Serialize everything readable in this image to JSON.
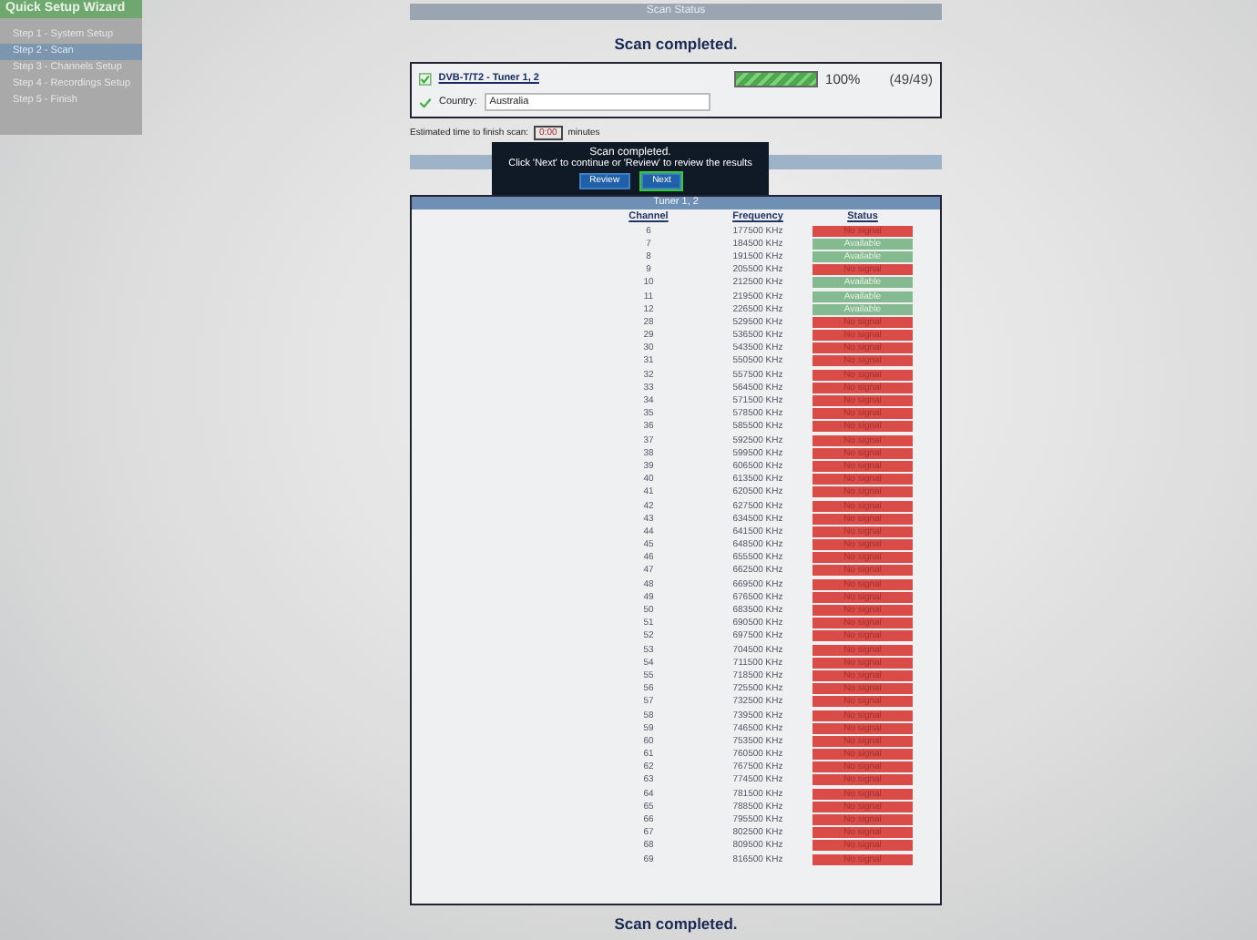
{
  "sidebar": {
    "title": "Quick Setup Wizard",
    "items": [
      {
        "label": "Step 1 - System Setup",
        "selected": false
      },
      {
        "label": "Step 2 - Scan",
        "selected": true
      },
      {
        "label": "Step 3 - Channels Setup",
        "selected": false
      },
      {
        "label": "Step 4 - Recordings Setup",
        "selected": false
      },
      {
        "label": "Step 5 - Finish",
        "selected": false
      }
    ]
  },
  "header": "Scan Status",
  "status_title": "Scan completed.",
  "tuner": {
    "name": "DVB-T/T2 - Tuner 1, 2",
    "level": 1,
    "percent": "100%",
    "count": "(49/49)",
    "country_label": "Country:",
    "country": "Australia"
  },
  "estimate": {
    "label": "Estimated time to finish scan:",
    "value": "0:00",
    "unit": "minutes"
  },
  "dialog": {
    "title": "Scan completed.",
    "message": "Click 'Next' to continue or 'Review' to review the results",
    "buttons": [
      {
        "label": "Review",
        "selected": false
      },
      {
        "label": "Next",
        "selected": true
      }
    ]
  },
  "table": {
    "title": "Tuner 1, 2",
    "columns": [
      "Channel",
      "Frequency",
      "Status"
    ],
    "rows": [
      {
        "channel": "6",
        "frequency": "177500 KHz",
        "status": "No signal",
        "kind": "none"
      },
      {
        "channel": "7",
        "frequency": "184500 KHz",
        "status": "Available",
        "kind": "available"
      },
      {
        "channel": "8",
        "frequency": "191500 KHz",
        "status": "Available",
        "kind": "available"
      },
      {
        "channel": "9",
        "frequency": "205500 KHz",
        "status": "No signal",
        "kind": "none"
      },
      {
        "channel": "10",
        "frequency": "212500 KHz",
        "status": "Available",
        "kind": "available"
      },
      {
        "channel": "11",
        "frequency": "219500 KHz",
        "status": "Available",
        "kind": "available"
      },
      {
        "channel": "12",
        "frequency": "226500 KHz",
        "status": "Available",
        "kind": "available"
      },
      {
        "channel": "28",
        "frequency": "529500 KHz",
        "status": "No signal",
        "kind": "none"
      },
      {
        "channel": "29",
        "frequency": "536500 KHz",
        "status": "No signal",
        "kind": "none"
      },
      {
        "channel": "30",
        "frequency": "543500 KHz",
        "status": "No signal",
        "kind": "none"
      },
      {
        "channel": "31",
        "frequency": "550500 KHz",
        "status": "No signal",
        "kind": "none"
      },
      {
        "channel": "32",
        "frequency": "557500 KHz",
        "status": "No signal",
        "kind": "none"
      },
      {
        "channel": "33",
        "frequency": "564500 KHz",
        "status": "No signal",
        "kind": "none"
      },
      {
        "channel": "34",
        "frequency": "571500 KHz",
        "status": "No signal",
        "kind": "none"
      },
      {
        "channel": "35",
        "frequency": "578500 KHz",
        "status": "No signal",
        "kind": "none"
      },
      {
        "channel": "36",
        "frequency": "585500 KHz",
        "status": "No signal",
        "kind": "none"
      },
      {
        "channel": "37",
        "frequency": "592500 KHz",
        "status": "No signal",
        "kind": "none"
      },
      {
        "channel": "38",
        "frequency": "599500 KHz",
        "status": "No signal",
        "kind": "none"
      },
      {
        "channel": "39",
        "frequency": "606500 KHz",
        "status": "No signal",
        "kind": "none"
      },
      {
        "channel": "40",
        "frequency": "613500 KHz",
        "status": "No signal",
        "kind": "none"
      },
      {
        "channel": "41",
        "frequency": "620500 KHz",
        "status": "No signal",
        "kind": "none"
      },
      {
        "channel": "42",
        "frequency": "627500 KHz",
        "status": "No signal",
        "kind": "none"
      },
      {
        "channel": "43",
        "frequency": "634500 KHz",
        "status": "No signal",
        "kind": "none"
      },
      {
        "channel": "44",
        "frequency": "641500 KHz",
        "status": "No signal",
        "kind": "none"
      },
      {
        "channel": "45",
        "frequency": "648500 KHz",
        "status": "No signal",
        "kind": "none"
      },
      {
        "channel": "46",
        "frequency": "655500 KHz",
        "status": "No signal",
        "kind": "none"
      },
      {
        "channel": "47",
        "frequency": "662500 KHz",
        "status": "No signal",
        "kind": "none"
      },
      {
        "channel": "48",
        "frequency": "669500 KHz",
        "status": "No signal",
        "kind": "none"
      },
      {
        "channel": "49",
        "frequency": "676500 KHz",
        "status": "No signal",
        "kind": "none"
      },
      {
        "channel": "50",
        "frequency": "683500 KHz",
        "status": "No signal",
        "kind": "none"
      },
      {
        "channel": "51",
        "frequency": "690500 KHz",
        "status": "No signal",
        "kind": "none"
      },
      {
        "channel": "52",
        "frequency": "697500 KHz",
        "status": "No signal",
        "kind": "none"
      },
      {
        "channel": "53",
        "frequency": "704500 KHz",
        "status": "No signal",
        "kind": "none"
      },
      {
        "channel": "54",
        "frequency": "711500 KHz",
        "status": "No signal",
        "kind": "none"
      },
      {
        "channel": "55",
        "frequency": "718500 KHz",
        "status": "No signal",
        "kind": "none"
      },
      {
        "channel": "56",
        "frequency": "725500 KHz",
        "status": "No signal",
        "kind": "none"
      },
      {
        "channel": "57",
        "frequency": "732500 KHz",
        "status": "No signal",
        "kind": "none"
      },
      {
        "channel": "58",
        "frequency": "739500 KHz",
        "status": "No signal",
        "kind": "none"
      },
      {
        "channel": "59",
        "frequency": "746500 KHz",
        "status": "No signal",
        "kind": "none"
      },
      {
        "channel": "60",
        "frequency": "753500 KHz",
        "status": "No signal",
        "kind": "none"
      },
      {
        "channel": "61",
        "frequency": "760500 KHz",
        "status": "No signal",
        "kind": "none"
      },
      {
        "channel": "62",
        "frequency": "767500 KHz",
        "status": "No signal",
        "kind": "none"
      },
      {
        "channel": "63",
        "frequency": "774500 KHz",
        "status": "No signal",
        "kind": "none"
      },
      {
        "channel": "64",
        "frequency": "781500 KHz",
        "status": "No signal",
        "kind": "none"
      },
      {
        "channel": "65",
        "frequency": "788500 KHz",
        "status": "No signal",
        "kind": "none"
      },
      {
        "channel": "66",
        "frequency": "795500 KHz",
        "status": "No signal",
        "kind": "none"
      },
      {
        "channel": "67",
        "frequency": "802500 KHz",
        "status": "No signal",
        "kind": "none"
      },
      {
        "channel": "68",
        "frequency": "809500 KHz",
        "status": "No signal",
        "kind": "none"
      },
      {
        "channel": "69",
        "frequency": "816500 KHz",
        "status": "No signal",
        "kind": "none"
      }
    ]
  },
  "footer": "Scan completed."
}
